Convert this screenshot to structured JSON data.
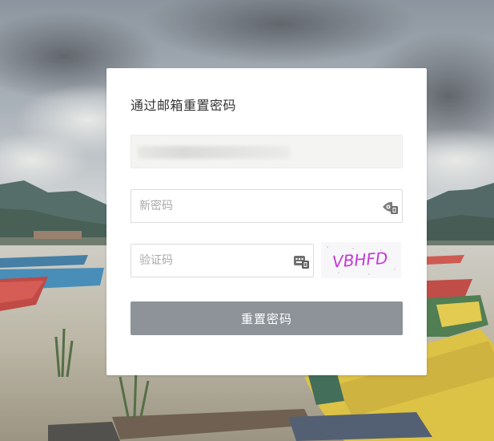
{
  "reset_form": {
    "title": "通过邮箱重置密码",
    "email_value": "",
    "new_password_placeholder": "新密码",
    "captcha_placeholder": "验证码",
    "captcha_text": "VBHFD",
    "submit_label": "重置密码"
  },
  "colors": {
    "button_bg": "#8e939a",
    "captcha_text": "#c23ad6",
    "card_bg": "#ffffff"
  },
  "icons": {
    "password_field": "password-keyboard-icon",
    "captcha_field": "keyboard-icon"
  }
}
